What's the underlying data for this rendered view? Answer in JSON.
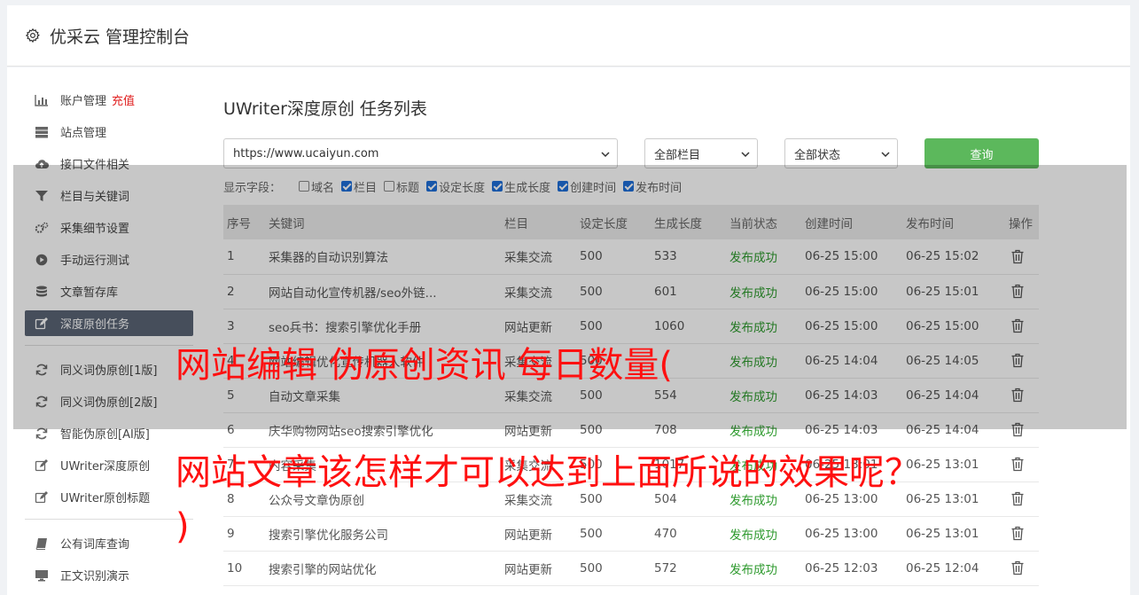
{
  "header": {
    "title": "优采云 管理控制台"
  },
  "sidebar": {
    "group1": [
      {
        "label": "账户管理",
        "badge": "充值",
        "icon": "bar-chart-icon"
      },
      {
        "label": "站点管理",
        "icon": "server-icon"
      },
      {
        "label": "接口文件相关",
        "icon": "cloud-upload-icon"
      },
      {
        "label": "栏目与关键词",
        "icon": "filter-icon"
      },
      {
        "label": "采集细节设置",
        "icon": "gears-icon"
      },
      {
        "label": "手动运行测试",
        "icon": "play-circle-icon"
      },
      {
        "label": "文章暂存库",
        "icon": "database-icon"
      },
      {
        "label": "深度原创任务",
        "icon": "edit-icon",
        "active": true
      }
    ],
    "group2": [
      {
        "label": "同义词伪原创[1版]",
        "icon": "refresh-icon"
      },
      {
        "label": "同义词伪原创[2版]",
        "icon": "refresh-icon"
      },
      {
        "label": "智能伪原创[AI版]",
        "icon": "refresh-icon"
      },
      {
        "label": "UWriter深度原创",
        "icon": "edit-icon"
      },
      {
        "label": "UWriter原创标题",
        "icon": "edit-icon"
      }
    ],
    "group3": [
      {
        "label": "公有词库查询",
        "icon": "book-icon"
      },
      {
        "label": "正文识别演示",
        "icon": "monitor-icon"
      }
    ]
  },
  "page": {
    "title": "UWriter深度原创 任务列表"
  },
  "filters": {
    "site": "https://www.ucaiyun.com",
    "column": "全部栏目",
    "status": "全部状态",
    "query_label": "查询"
  },
  "fields": {
    "label": "显示字段：",
    "items": [
      {
        "label": "域名",
        "checked": false
      },
      {
        "label": "栏目",
        "checked": true
      },
      {
        "label": "标题",
        "checked": false
      },
      {
        "label": "设定长度",
        "checked": true
      },
      {
        "label": "生成长度",
        "checked": true
      },
      {
        "label": "创建时间",
        "checked": true
      },
      {
        "label": "发布时间",
        "checked": true
      }
    ]
  },
  "table": {
    "headers": [
      "序号",
      "关键词",
      "栏目",
      "设定长度",
      "生成长度",
      "当前状态",
      "创建时间",
      "发布时间",
      "操作"
    ],
    "rows": [
      [
        "1",
        "采集器的自动识别算法",
        "采集交流",
        "500",
        "533",
        "发布成功",
        "06-25 15:00",
        "06-25 15:02"
      ],
      [
        "2",
        "网站自动化宣传机器/seo外链...",
        "采集交流",
        "500",
        "601",
        "发布成功",
        "06-25 15:00",
        "06-25 15:01"
      ],
      [
        "3",
        "seo兵书：搜索引擎优化手册",
        "网站更新",
        "500",
        "1060",
        "发布成功",
        "06-25 15:00",
        "06-25 15:00"
      ],
      [
        "4",
        "网站编辑优化宣传机器人软件",
        "采集交流",
        "500",
        "",
        "发布成功",
        "06-25 14:04",
        "06-25 14:05"
      ],
      [
        "5",
        "自动文章采集",
        "采集交流",
        "500",
        "554",
        "发布成功",
        "06-25 14:03",
        "06-25 14:04"
      ],
      [
        "6",
        "庆华购物网站seo搜索引擎优化",
        "网站更新",
        "500",
        "708",
        "发布成功",
        "06-25 14:03",
        "06-25 14:04"
      ],
      [
        "7",
        "内容采集",
        "采集交流",
        "500",
        "1017",
        "发布成功",
        "06-25 13:01",
        "06-25 13:01"
      ],
      [
        "8",
        "公众号文章伪原创",
        "采集交流",
        "500",
        "504",
        "发布成功",
        "06-25 13:00",
        "06-25 13:01"
      ],
      [
        "9",
        "搜索引擎优化服务公司",
        "网站更新",
        "500",
        "470",
        "发布成功",
        "06-25 13:00",
        "06-25 13:01"
      ],
      [
        "10",
        "搜索引擎的网站优化",
        "网站更新",
        "500",
        "572",
        "发布成功",
        "06-25 12:03",
        "06-25 12:04"
      ]
    ]
  },
  "overlay": {
    "line1": "网站编辑 伪原创资讯 每日数量(",
    "line2": "网站文章该怎样才可以达到上面所说的效果呢？",
    "line3": ")"
  },
  "colors": {
    "success": "#2e9a2e",
    "query": "#5cb85c",
    "active": "#5a6475",
    "overlay_text": "#ff1010"
  }
}
